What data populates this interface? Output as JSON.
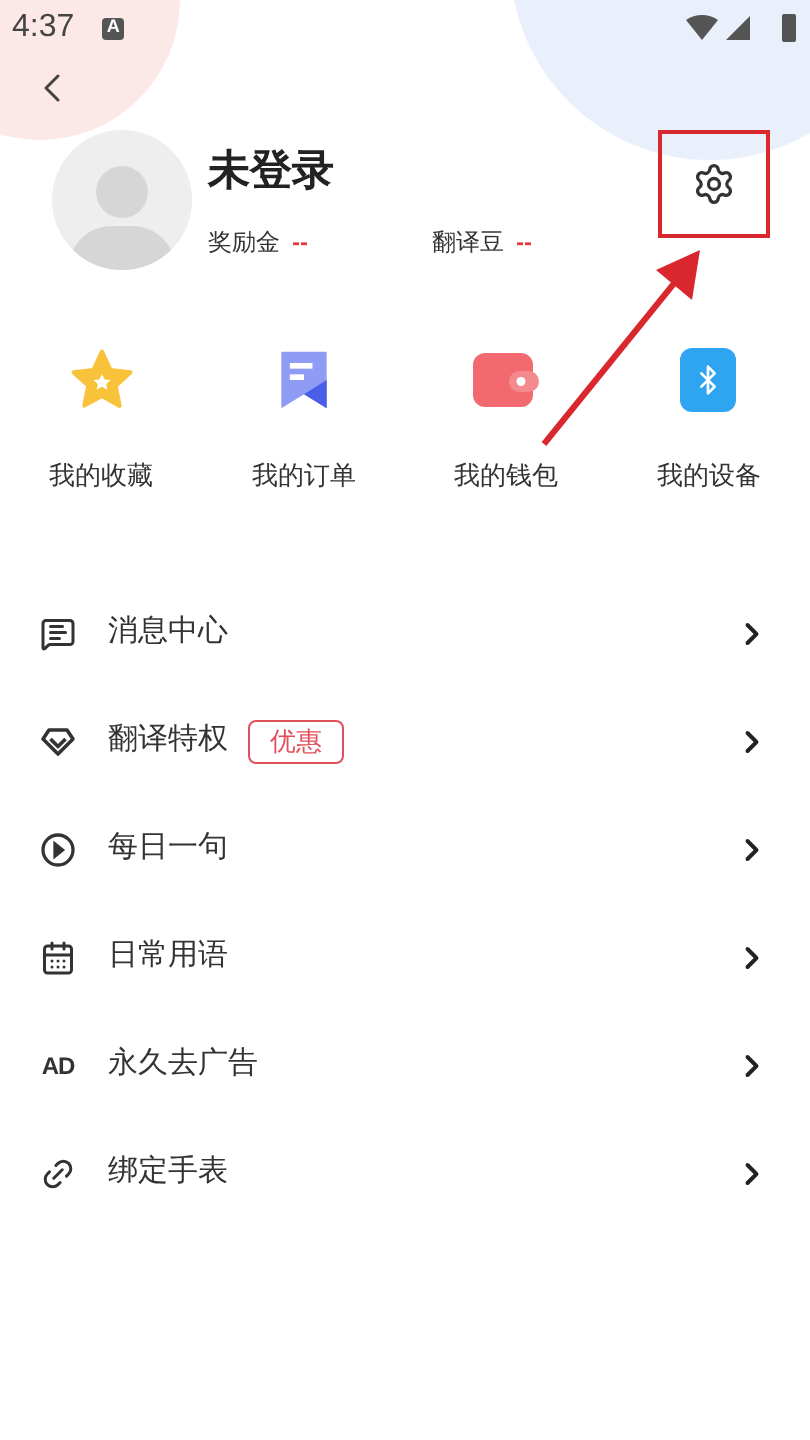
{
  "status_bar": {
    "time": "4:37",
    "notification_icon": "A"
  },
  "profile": {
    "name": "未登录",
    "stats": [
      {
        "label": "奖励金",
        "value": "--"
      },
      {
        "label": "翻译豆",
        "value": "--"
      }
    ],
    "settings_highlighted": true
  },
  "shortcuts": [
    {
      "kind": "star",
      "label": "我的收藏"
    },
    {
      "kind": "order",
      "label": "我的订单"
    },
    {
      "kind": "wallet",
      "label": "我的钱包"
    },
    {
      "kind": "bluetooth",
      "label": "我的设备"
    }
  ],
  "menu": [
    {
      "kind": "message",
      "label": "消息中心"
    },
    {
      "kind": "diamond",
      "label": "翻译特权",
      "badge": "优惠"
    },
    {
      "kind": "play",
      "label": "每日一句"
    },
    {
      "kind": "calendar",
      "label": "日常用语"
    },
    {
      "kind": "ad",
      "label": "永久去广告",
      "icon_text": "AD"
    },
    {
      "kind": "link",
      "label": "绑定手表"
    }
  ]
}
